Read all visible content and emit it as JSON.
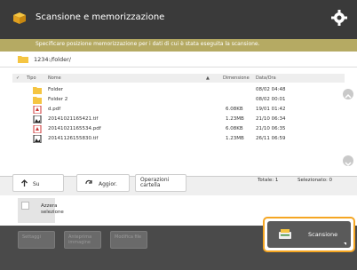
{
  "header": {
    "title": "Scansione e memorizzazione",
    "logo_icon": "folder-store-icon",
    "settings_icon": "gear-icon"
  },
  "subbar": {
    "text": "Specificare posizione memorizzazione per i dati di cui è stata eseguita la scansione."
  },
  "path": {
    "text": "1234:/folder/"
  },
  "columns": {
    "check": "✓",
    "type": "Tipo",
    "name": "Nome",
    "sort": "▲",
    "size": "Dimensione",
    "date": "Data/Ora"
  },
  "files": [
    {
      "type": "folder",
      "name": "Folder",
      "size": "",
      "date": "08/02  04:48"
    },
    {
      "type": "folder",
      "name": "Folder 2",
      "size": "",
      "date": "08/02  00:01"
    },
    {
      "type": "pdf",
      "name": "d.pdf",
      "size": "6.08KB",
      "date": "19/01  01:42"
    },
    {
      "type": "tif",
      "name": "20141021165421.tif",
      "size": "1.23MB",
      "date": "21/10  06:34"
    },
    {
      "type": "pdf",
      "name": "20141021165534.pdf",
      "size": "6.08KB",
      "date": "21/10  06:35"
    },
    {
      "type": "tif",
      "name": "20141126155830.tif",
      "size": "1.23MB",
      "date": "26/11  06:59"
    }
  ],
  "nav": {
    "up": "Su",
    "update": "Aggior.",
    "file_ops": "Operazioni cartella",
    "total": "Totale: 1",
    "selected": "Selezionato: 0"
  },
  "select_all": "Azzera selezione",
  "bottom": {
    "settings": "Settaggi",
    "preview": "Anteprima immagine",
    "rename": "Modifica file"
  },
  "scan": {
    "label": "Scansione"
  },
  "colors": {
    "accent": "#f5a623",
    "header": "#3a3a3a",
    "subbar": "#b5aa63"
  }
}
